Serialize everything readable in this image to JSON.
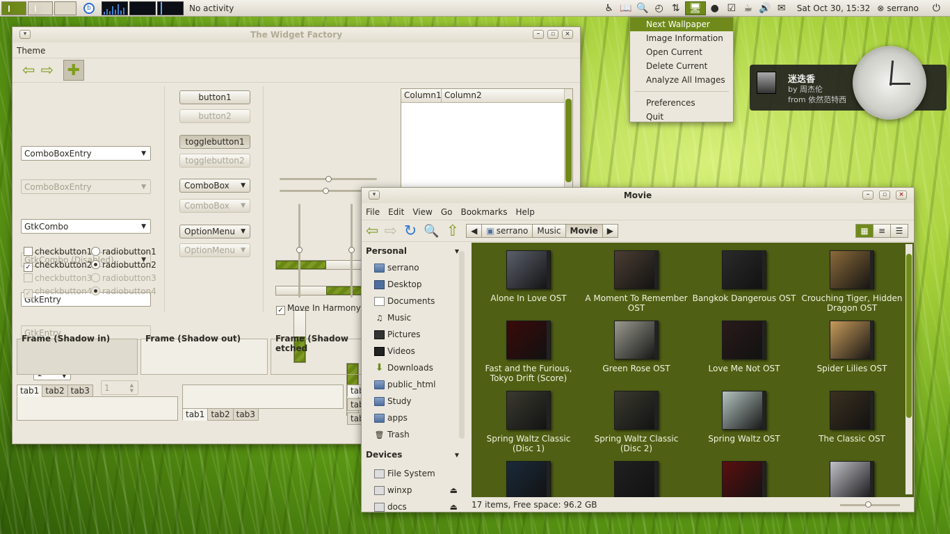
{
  "panel": {
    "activity": "No activity",
    "datetime": "Sat Oct 30, 15:32",
    "user": "serrano",
    "accent": "#6f8a1a"
  },
  "menu": {
    "items": [
      "Next Wallpaper",
      "Image Information",
      "Open Current",
      "Delete Current",
      "Analyze All Images"
    ],
    "items2": [
      "Preferences",
      "Quit"
    ]
  },
  "notification": {
    "title": "迷迭香",
    "by": "by 周杰伦",
    "from": "from 依然范特西"
  },
  "widget_factory": {
    "title": "The Widget Factory",
    "menu": "Theme",
    "combo1": "ComboBoxEntry",
    "combo1_dis": "ComboBoxEntry",
    "gtkcombo": "GtkCombo",
    "gtkcombo_dis": "GtkCombo (Disabled)",
    "entry1": "GtkEntry",
    "entry2": "GtkEntry",
    "spin1": "1",
    "spin2": "1",
    "checks": [
      "checkbutton1",
      "checkbutton2",
      "checkbutton3",
      "checkbutton4"
    ],
    "radios": [
      "radiobutton1",
      "radiobutton2",
      "radiobutton3",
      "radiobutton4"
    ],
    "button1": "button1",
    "button2": "button2",
    "toggle1": "togglebutton1",
    "toggle2": "togglebutton2",
    "combobox1": "ComboBox",
    "combobox2": "ComboBox",
    "option1": "OptionMenu",
    "option2": "OptionMenu",
    "harmony": "Move In Harmony",
    "col1": "Column1",
    "col2": "Column2",
    "frame1": "Frame (Shadow in)",
    "frame2": "Frame (Shadow out)",
    "frame3": "Frame (Shadow etched",
    "tabs": [
      "tab1",
      "tab2",
      "tab3"
    ],
    "tabs_side": [
      "tab",
      "tab",
      "tab"
    ]
  },
  "file_manager": {
    "title": "Movie",
    "menu": [
      "File",
      "Edit",
      "View",
      "Go",
      "Bookmarks",
      "Help"
    ],
    "path": [
      "serrano",
      "Music",
      "Movie"
    ],
    "personal_header": "Personal",
    "personal": [
      "serrano",
      "Desktop",
      "Documents",
      "Music",
      "Pictures",
      "Videos",
      "Downloads",
      "public_html",
      "Study",
      "apps",
      "Trash"
    ],
    "devices_header": "Devices",
    "devices": [
      "File System",
      "winxp",
      "docs"
    ],
    "albums": [
      "Alone In Love OST",
      "A Moment To Remember OST",
      "Bangkok Dangerous OST",
      "Crouching Tiger, Hidden Dragon OST",
      "Fast and the Furious, Tokyo Drift (Score)",
      "Green Rose OST",
      "Love Me Not OST",
      "Spider Lilies OST",
      "Spring Waltz Classic (Disc 1)",
      "Spring Waltz Classic (Disc 2)",
      "Spring Waltz OST",
      "The Classic OST"
    ],
    "status": "17 items, Free space: 96.2 GB",
    "bg": "#4f5f14"
  }
}
